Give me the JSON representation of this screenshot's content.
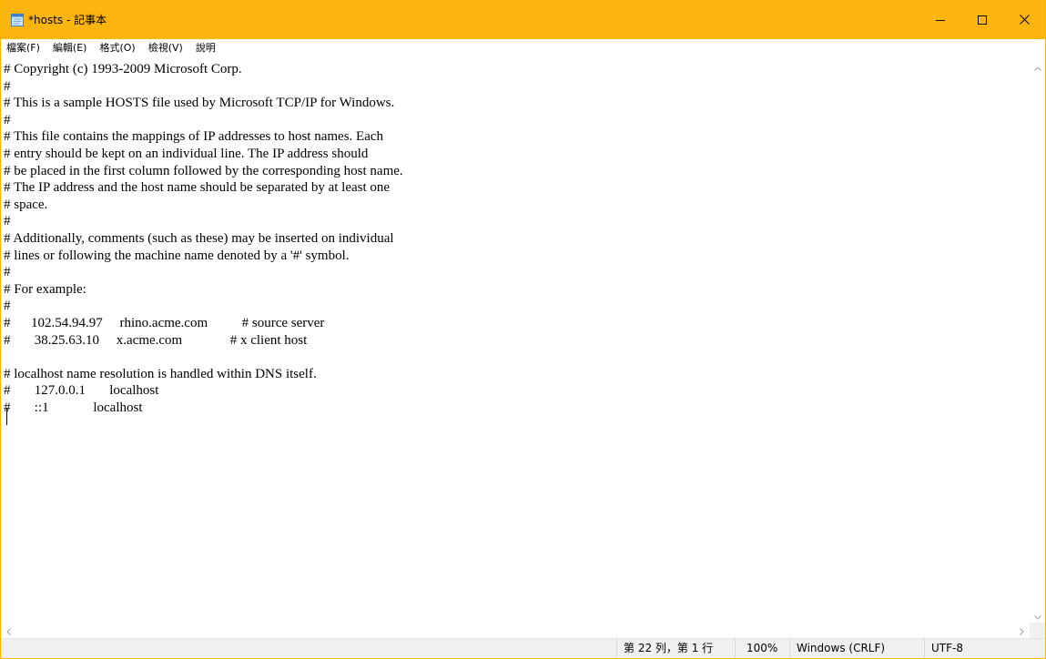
{
  "window": {
    "title": "*hosts - 記事本",
    "accent_color": "#fcb40f",
    "icons": {
      "app": "notepad-icon",
      "minimize": "minimize-icon",
      "maximize": "maximize-icon",
      "close": "close-icon"
    }
  },
  "menu": {
    "items": [
      {
        "label": "檔案(F)"
      },
      {
        "label": "編輯(E)"
      },
      {
        "label": "格式(O)"
      },
      {
        "label": "檢視(V)"
      },
      {
        "label": "說明"
      }
    ]
  },
  "editor": {
    "content": "# Copyright (c) 1993-2009 Microsoft Corp.\n#\n# This is a sample HOSTS file used by Microsoft TCP/IP for Windows.\n#\n# This file contains the mappings of IP addresses to host names. Each\n# entry should be kept on an individual line. The IP address should\n# be placed in the first column followed by the corresponding host name.\n# The IP address and the host name should be separated by at least one\n# space.\n#\n# Additionally, comments (such as these) may be inserted on individual\n# lines or following the machine name denoted by a '#' symbol.\n#\n# For example:\n#\n#      102.54.94.97     rhino.acme.com          # source server\n#       38.25.63.10     x.acme.com              # x client host\n\n# localhost name resolution is handled within DNS itself.\n#       127.0.0.1       localhost\n#       ::1             localhost\n"
  },
  "status": {
    "position": "第 22 列，第 1 行",
    "zoom": "100%",
    "line_ending": "Windows (CRLF)",
    "encoding": "UTF-8"
  }
}
